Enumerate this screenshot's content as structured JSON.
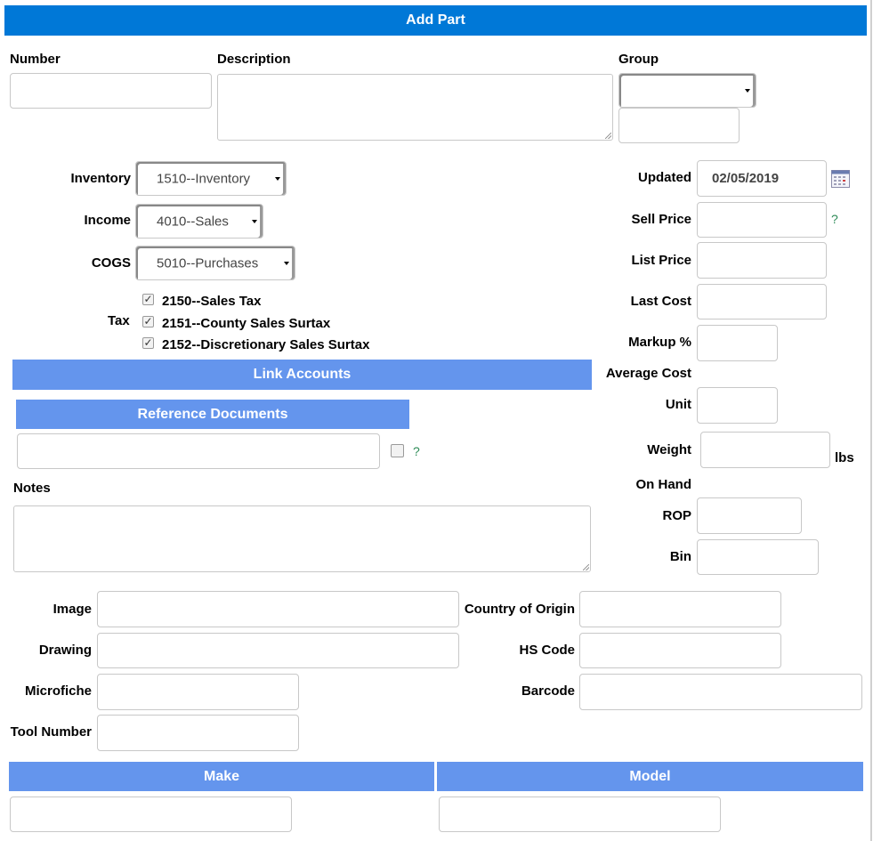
{
  "header": {
    "title": "Add Part"
  },
  "fields": {
    "number": "Number",
    "description": "Description",
    "group": "Group",
    "inventory": {
      "label": "Inventory",
      "value": "1510--Inventory"
    },
    "income": {
      "label": "Income",
      "value": "4010--Sales"
    },
    "cogs": {
      "label": "COGS",
      "value": "5010--Purchases"
    },
    "tax": {
      "label": "Tax",
      "items": [
        {
          "label": "2150--Sales Tax",
          "checked": true
        },
        {
          "label": "2151--County Sales Surtax",
          "checked": true
        },
        {
          "label": "2152--Discretionary Sales Surtax",
          "checked": true
        }
      ]
    },
    "updated": {
      "label": "Updated",
      "value": "02/05/2019"
    },
    "sell_price": "Sell Price",
    "list_price": "List Price",
    "last_cost": "Last Cost",
    "markup": "Markup %",
    "average_cost": "Average Cost",
    "unit": "Unit",
    "weight": "Weight",
    "weight_unit": "lbs",
    "on_hand": "On Hand",
    "rop": "ROP",
    "bin": "Bin",
    "notes": "Notes",
    "image": "Image",
    "drawing": "Drawing",
    "microfiche": "Microfiche",
    "tool_number": "Tool Number",
    "country_of_origin": "Country of Origin",
    "hs_code": "HS Code",
    "barcode": "Barcode",
    "help": "?"
  },
  "sections": {
    "link_accounts": "Link Accounts",
    "reference_documents": "Reference Documents",
    "make": "Make",
    "model": "Model"
  },
  "colors": {
    "header": "#0078d7",
    "section": "#6495ed"
  }
}
